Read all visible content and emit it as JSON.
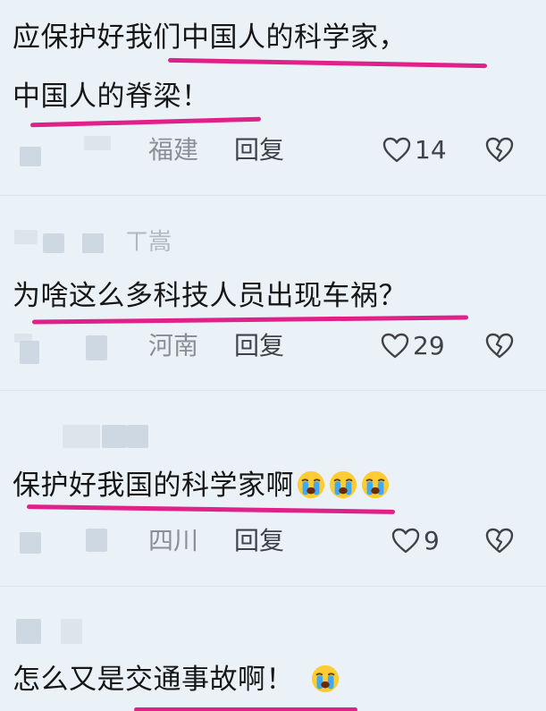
{
  "colors": {
    "background": "#eaf2f8",
    "highlight_underline": "#e0218a",
    "location_text": "#8b8f94",
    "action_text": "#3f4246"
  },
  "comments": [
    {
      "text_lines": [
        "应保护好我们中国人的科学家，",
        "中国人的脊梁！"
      ],
      "location": "福建",
      "reply_label": "回复",
      "likes": "14"
    },
    {
      "username_fragment": "ㄒ嵩",
      "text_lines": [
        "为啥这么多科技人员出现车祸？"
      ],
      "location": "河南",
      "reply_label": "回复",
      "likes": "29"
    },
    {
      "text_lines": [
        "保护好我国的科学家啊"
      ],
      "emojis": [
        "crying-face-emoji",
        "crying-face-emoji",
        "crying-face-emoji"
      ],
      "location": "四川",
      "reply_label": "回复",
      "likes": "9"
    },
    {
      "text_lines": [
        "怎么又是交通事故啊！"
      ],
      "emojis": [
        "crying-face-emoji"
      ]
    }
  ],
  "icons": {
    "like": "heart-outline-icon",
    "dislike": "broken-heart-icon"
  }
}
